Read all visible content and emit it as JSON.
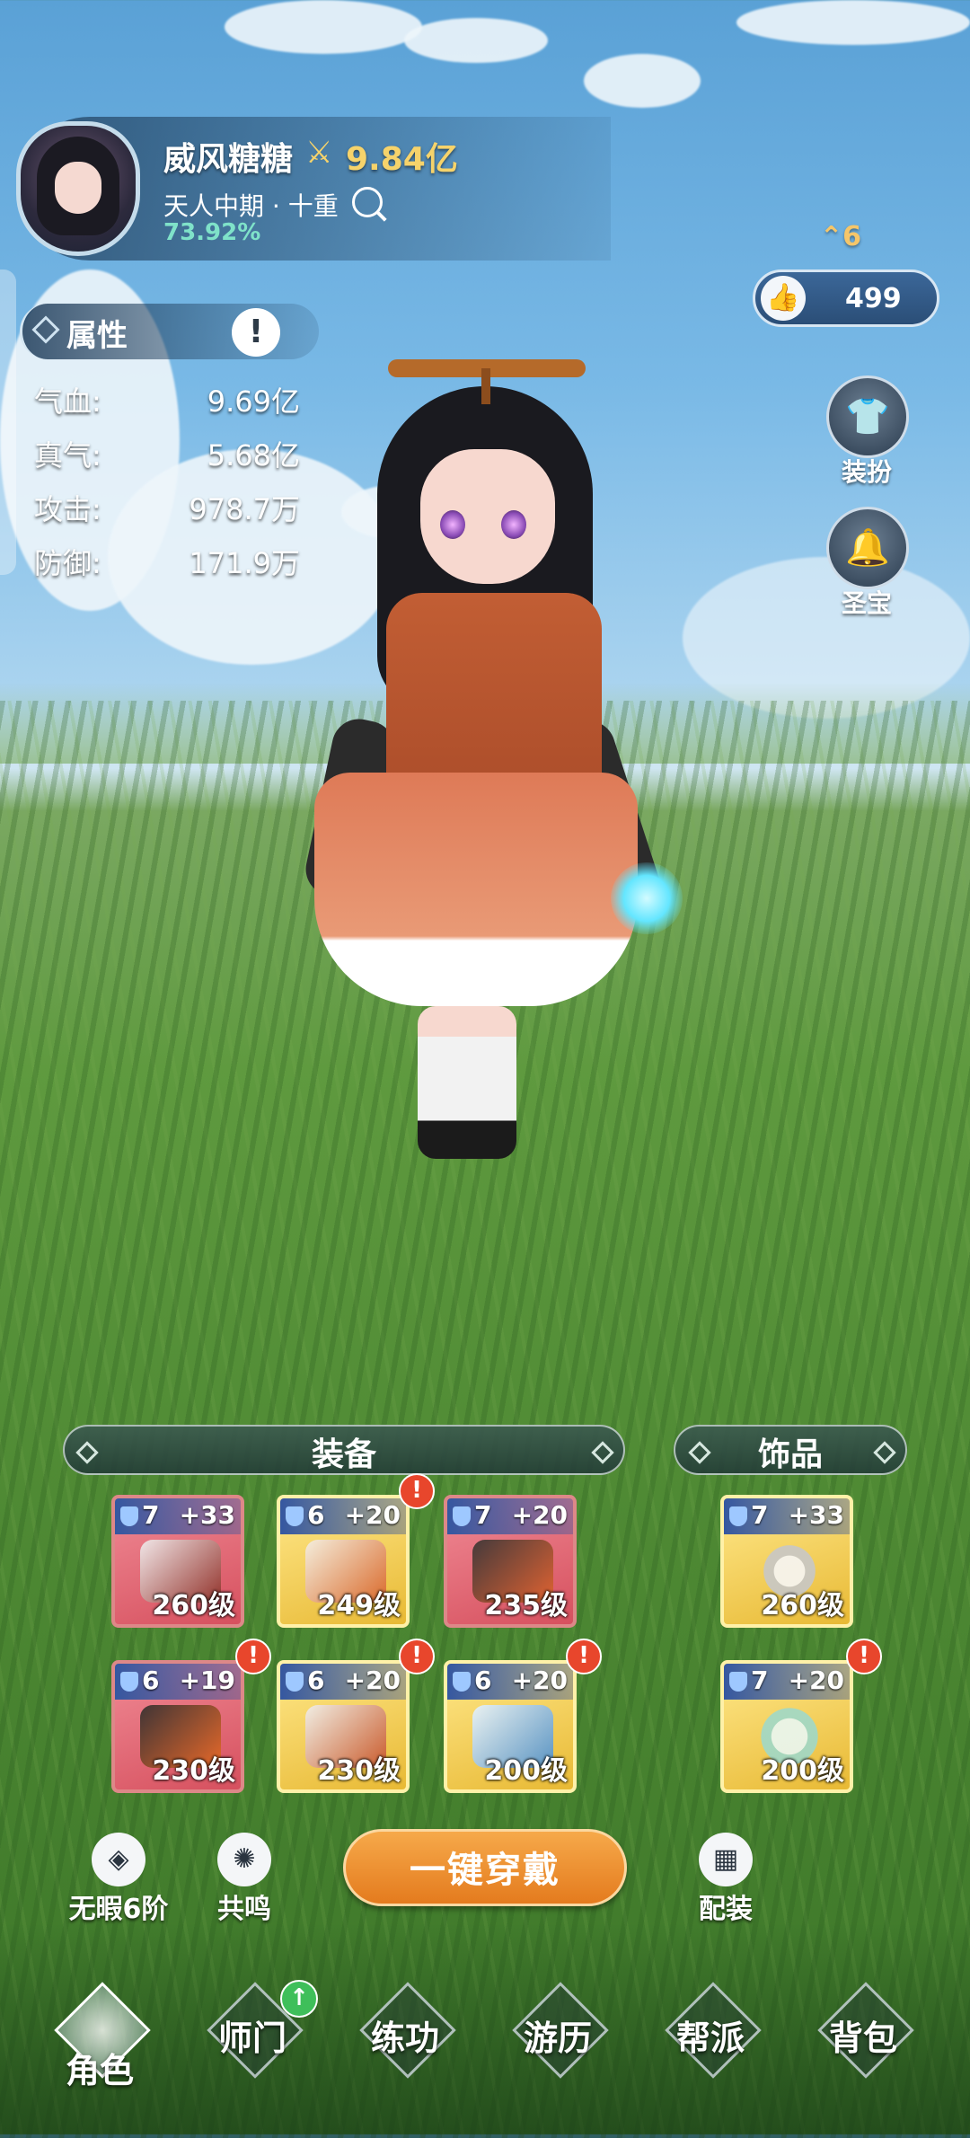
{
  "player": {
    "name": "威风糖糖",
    "power": "9.84亿",
    "realm": "天人中期 · 十重",
    "progress": "73.92%"
  },
  "rank": {
    "value": "6"
  },
  "likes": {
    "count": "499"
  },
  "side_buttons": [
    {
      "label": "装扮",
      "icon": "outfit-icon"
    },
    {
      "label": "圣宝",
      "icon": "bell-icon"
    }
  ],
  "attributes": {
    "title": "属性",
    "info_icon": "!",
    "rows": [
      {
        "label": "气血:",
        "value": "9.69亿"
      },
      {
        "label": "真气:",
        "value": "5.68亿"
      },
      {
        "label": "攻击:",
        "value": "978.7万"
      },
      {
        "label": "防御:",
        "value": "171.9万"
      }
    ]
  },
  "equipment": {
    "title": "装备",
    "items": [
      {
        "tier": "7",
        "plus": "+33",
        "level": "260级",
        "style": "red",
        "alert": false
      },
      {
        "tier": "6",
        "plus": "+20",
        "level": "249级",
        "style": "gold",
        "alert": true
      },
      {
        "tier": "7",
        "plus": "+20",
        "level": "235级",
        "style": "red",
        "alert": false
      },
      {
        "tier": "6",
        "plus": "+19",
        "level": "230级",
        "style": "red",
        "alert": true
      },
      {
        "tier": "6",
        "plus": "+20",
        "level": "230级",
        "style": "gold",
        "alert": true
      },
      {
        "tier": "6",
        "plus": "+20",
        "level": "200级",
        "style": "gold",
        "alert": true
      }
    ]
  },
  "accessories": {
    "title": "饰品",
    "items": [
      {
        "tier": "7",
        "plus": "+33",
        "level": "260级",
        "style": "gold",
        "alert": false
      },
      {
        "tier": "7",
        "plus": "+20",
        "level": "200级",
        "style": "gold",
        "alert": true
      }
    ]
  },
  "actions": {
    "flawless": "无暇6阶",
    "resonance": "共鸣",
    "equip_all": "一键穿戴",
    "loadout": "配装"
  },
  "nav": [
    {
      "label": "角色",
      "active": true
    },
    {
      "label": "师门",
      "badge": "↑"
    },
    {
      "label": "练功"
    },
    {
      "label": "游历"
    },
    {
      "label": "帮派"
    },
    {
      "label": "背包"
    }
  ],
  "colors": {
    "power": "#f6d36b",
    "progress": "#7fe2c9",
    "equip_button": "#e47b1e",
    "alert": "#e8462c"
  }
}
